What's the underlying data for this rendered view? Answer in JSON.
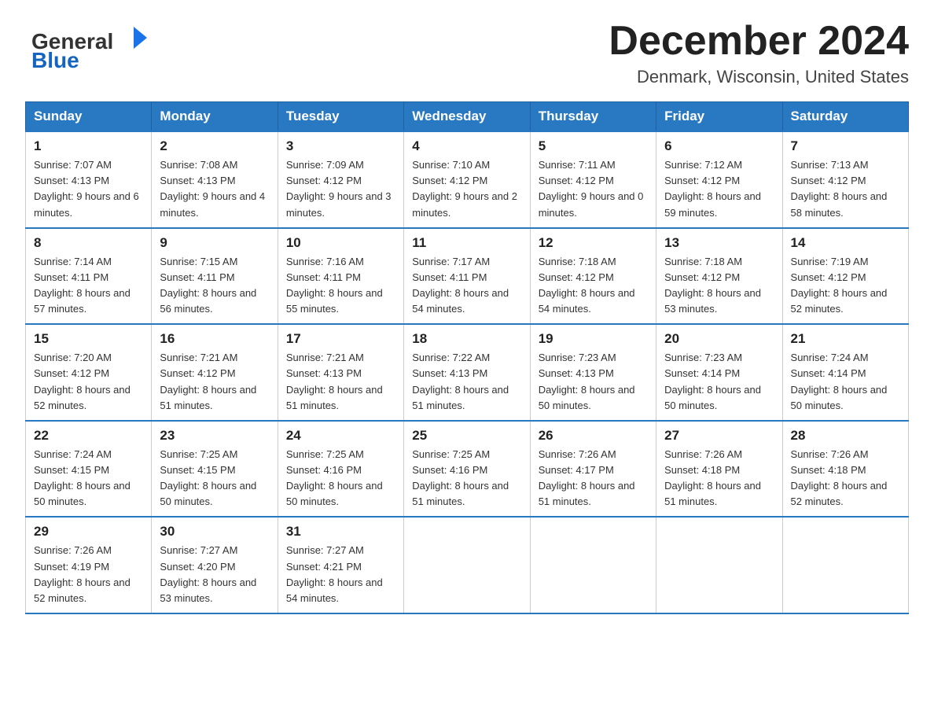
{
  "header": {
    "logo": {
      "general": "General",
      "blue": "Blue"
    },
    "title": "December 2024",
    "location": "Denmark, Wisconsin, United States"
  },
  "weekdays": [
    "Sunday",
    "Monday",
    "Tuesday",
    "Wednesday",
    "Thursday",
    "Friday",
    "Saturday"
  ],
  "weeks": [
    [
      {
        "day": "1",
        "sunrise": "7:07 AM",
        "sunset": "4:13 PM",
        "daylight": "9 hours and 6 minutes."
      },
      {
        "day": "2",
        "sunrise": "7:08 AM",
        "sunset": "4:13 PM",
        "daylight": "9 hours and 4 minutes."
      },
      {
        "day": "3",
        "sunrise": "7:09 AM",
        "sunset": "4:12 PM",
        "daylight": "9 hours and 3 minutes."
      },
      {
        "day": "4",
        "sunrise": "7:10 AM",
        "sunset": "4:12 PM",
        "daylight": "9 hours and 2 minutes."
      },
      {
        "day": "5",
        "sunrise": "7:11 AM",
        "sunset": "4:12 PM",
        "daylight": "9 hours and 0 minutes."
      },
      {
        "day": "6",
        "sunrise": "7:12 AM",
        "sunset": "4:12 PM",
        "daylight": "8 hours and 59 minutes."
      },
      {
        "day": "7",
        "sunrise": "7:13 AM",
        "sunset": "4:12 PM",
        "daylight": "8 hours and 58 minutes."
      }
    ],
    [
      {
        "day": "8",
        "sunrise": "7:14 AM",
        "sunset": "4:11 PM",
        "daylight": "8 hours and 57 minutes."
      },
      {
        "day": "9",
        "sunrise": "7:15 AM",
        "sunset": "4:11 PM",
        "daylight": "8 hours and 56 minutes."
      },
      {
        "day": "10",
        "sunrise": "7:16 AM",
        "sunset": "4:11 PM",
        "daylight": "8 hours and 55 minutes."
      },
      {
        "day": "11",
        "sunrise": "7:17 AM",
        "sunset": "4:11 PM",
        "daylight": "8 hours and 54 minutes."
      },
      {
        "day": "12",
        "sunrise": "7:18 AM",
        "sunset": "4:12 PM",
        "daylight": "8 hours and 54 minutes."
      },
      {
        "day": "13",
        "sunrise": "7:18 AM",
        "sunset": "4:12 PM",
        "daylight": "8 hours and 53 minutes."
      },
      {
        "day": "14",
        "sunrise": "7:19 AM",
        "sunset": "4:12 PM",
        "daylight": "8 hours and 52 minutes."
      }
    ],
    [
      {
        "day": "15",
        "sunrise": "7:20 AM",
        "sunset": "4:12 PM",
        "daylight": "8 hours and 52 minutes."
      },
      {
        "day": "16",
        "sunrise": "7:21 AM",
        "sunset": "4:12 PM",
        "daylight": "8 hours and 51 minutes."
      },
      {
        "day": "17",
        "sunrise": "7:21 AM",
        "sunset": "4:13 PM",
        "daylight": "8 hours and 51 minutes."
      },
      {
        "day": "18",
        "sunrise": "7:22 AM",
        "sunset": "4:13 PM",
        "daylight": "8 hours and 51 minutes."
      },
      {
        "day": "19",
        "sunrise": "7:23 AM",
        "sunset": "4:13 PM",
        "daylight": "8 hours and 50 minutes."
      },
      {
        "day": "20",
        "sunrise": "7:23 AM",
        "sunset": "4:14 PM",
        "daylight": "8 hours and 50 minutes."
      },
      {
        "day": "21",
        "sunrise": "7:24 AM",
        "sunset": "4:14 PM",
        "daylight": "8 hours and 50 minutes."
      }
    ],
    [
      {
        "day": "22",
        "sunrise": "7:24 AM",
        "sunset": "4:15 PM",
        "daylight": "8 hours and 50 minutes."
      },
      {
        "day": "23",
        "sunrise": "7:25 AM",
        "sunset": "4:15 PM",
        "daylight": "8 hours and 50 minutes."
      },
      {
        "day": "24",
        "sunrise": "7:25 AM",
        "sunset": "4:16 PM",
        "daylight": "8 hours and 50 minutes."
      },
      {
        "day": "25",
        "sunrise": "7:25 AM",
        "sunset": "4:16 PM",
        "daylight": "8 hours and 51 minutes."
      },
      {
        "day": "26",
        "sunrise": "7:26 AM",
        "sunset": "4:17 PM",
        "daylight": "8 hours and 51 minutes."
      },
      {
        "day": "27",
        "sunrise": "7:26 AM",
        "sunset": "4:18 PM",
        "daylight": "8 hours and 51 minutes."
      },
      {
        "day": "28",
        "sunrise": "7:26 AM",
        "sunset": "4:18 PM",
        "daylight": "8 hours and 52 minutes."
      }
    ],
    [
      {
        "day": "29",
        "sunrise": "7:26 AM",
        "sunset": "4:19 PM",
        "daylight": "8 hours and 52 minutes."
      },
      {
        "day": "30",
        "sunrise": "7:27 AM",
        "sunset": "4:20 PM",
        "daylight": "8 hours and 53 minutes."
      },
      {
        "day": "31",
        "sunrise": "7:27 AM",
        "sunset": "4:21 PM",
        "daylight": "8 hours and 54 minutes."
      },
      null,
      null,
      null,
      null
    ]
  ]
}
